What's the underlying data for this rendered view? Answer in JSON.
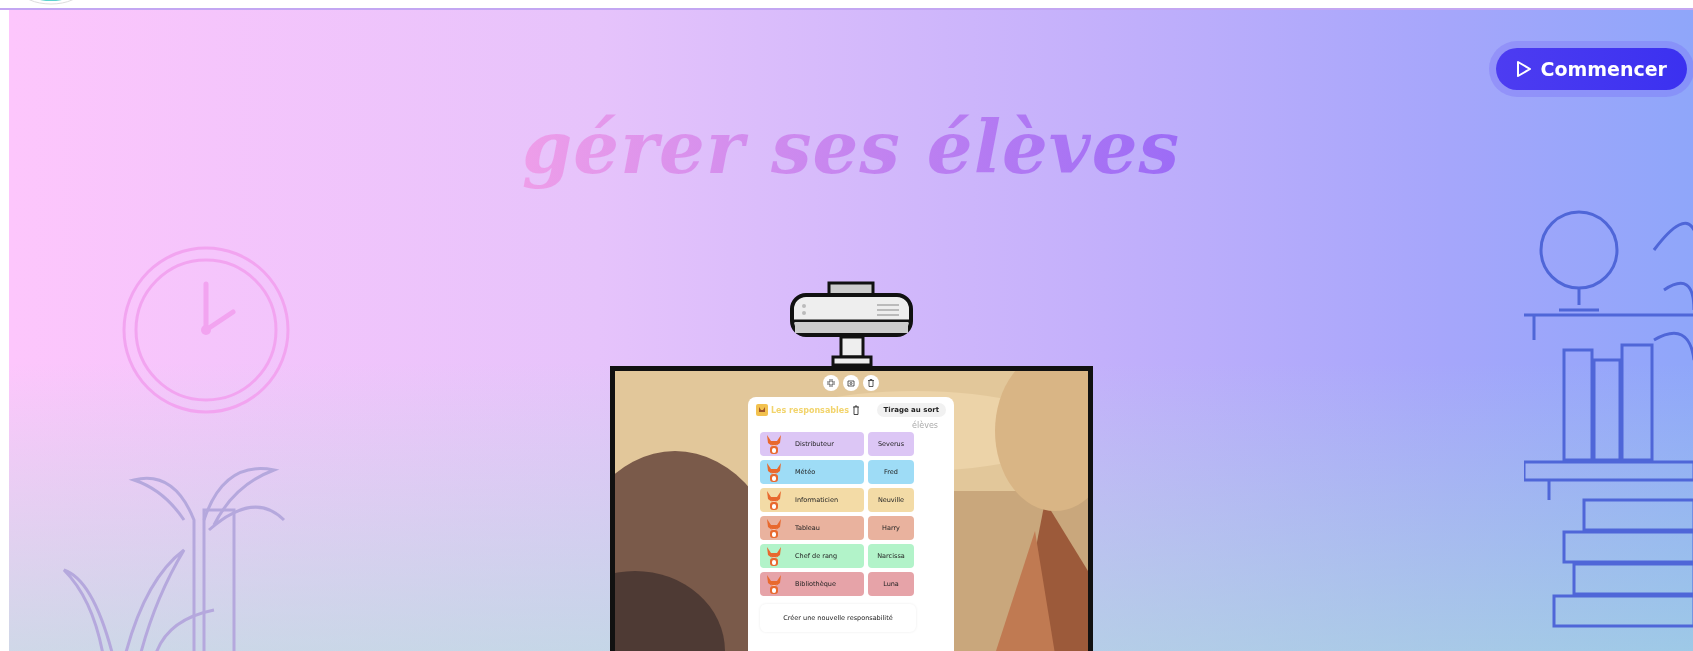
{
  "title": "gérer ses élèves",
  "start_button": {
    "label": "Commencer"
  },
  "widget": {
    "title": "Les responsables",
    "draw_button": "Tirage au sort",
    "column_header": "élèves",
    "rows": [
      {
        "role": "Distributeur",
        "student": "Severus",
        "color": "#dcc6f5"
      },
      {
        "role": "Météo",
        "student": "Fred",
        "color": "#9edcf6"
      },
      {
        "role": "Informaticien",
        "student": "Neuville",
        "color": "#f3dba6"
      },
      {
        "role": "Tableau",
        "student": "Harry",
        "color": "#e9b29e"
      },
      {
        "role": "Chef de rang",
        "student": "Narcissa",
        "color": "#b2f3c9"
      },
      {
        "role": "Bibliothèque",
        "student": "Luna",
        "color": "#e6a3a8"
      }
    ],
    "create_button": "Créer une nouvelle responsabilité"
  }
}
